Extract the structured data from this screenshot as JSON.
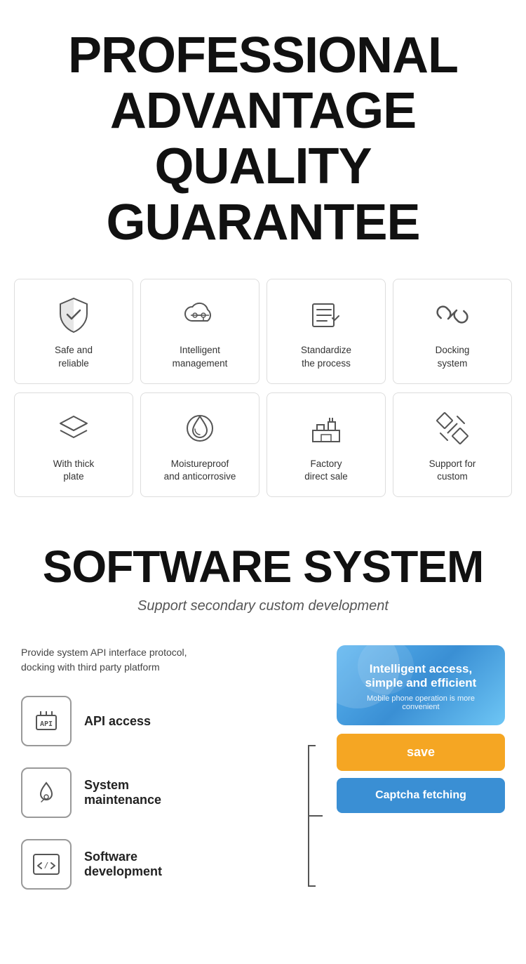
{
  "header": {
    "line1": "PROFESSIONAL",
    "line2": "ADVANTAGE",
    "line3": "QUALITY GUARANTEE"
  },
  "features": {
    "row1": [
      {
        "id": "safe-reliable",
        "label": "Safe and\nreliable",
        "icon": "shield"
      },
      {
        "id": "intelligent-management",
        "label": "Intelligent\nmanagement",
        "icon": "cloud-settings"
      },
      {
        "id": "standardize-process",
        "label": "Standardize\nthe process",
        "icon": "checklist"
      },
      {
        "id": "docking-system",
        "label": "Docking\nsystem",
        "icon": "link"
      }
    ],
    "row2": [
      {
        "id": "thick-plate",
        "label": "With thick\nplate",
        "icon": "layers"
      },
      {
        "id": "moistureproof",
        "label": "Moistureproof\nand anticorrosive",
        "icon": "leaf-drop"
      },
      {
        "id": "factory-direct",
        "label": "Factory\ndirect sale",
        "icon": "factory"
      },
      {
        "id": "support-custom",
        "label": "Support for\ncustom",
        "icon": "tools"
      }
    ]
  },
  "software": {
    "title": "SOFTWARE SYSTEM",
    "subtitle": "Support secondary custom development",
    "desc": "Provide system API interface protocol,\ndocking with third party platform",
    "items": [
      {
        "id": "api-access",
        "label": "API access",
        "icon": "api"
      },
      {
        "id": "system-maintenance",
        "label": "System\nmaintenance",
        "icon": "maintenance"
      },
      {
        "id": "software-development",
        "label": "Software\ndevelopment",
        "icon": "code"
      }
    ],
    "card": {
      "title": "Intelligent access,\nsimple and efficient",
      "subtitle": "Mobile phone operation is more convenient"
    },
    "btn_save": "save",
    "btn_captcha": "Captcha fetching"
  }
}
